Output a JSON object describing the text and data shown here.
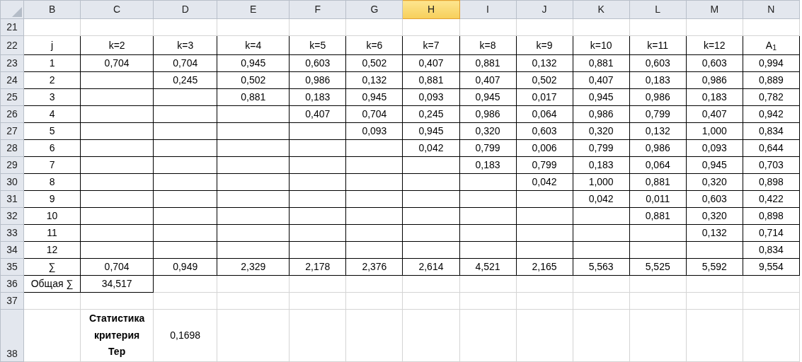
{
  "columns": [
    {
      "label": "B",
      "selected": false
    },
    {
      "label": "C",
      "selected": false
    },
    {
      "label": "D",
      "selected": false
    },
    {
      "label": "E",
      "selected": false
    },
    {
      "label": "F",
      "selected": false
    },
    {
      "label": "G",
      "selected": false
    },
    {
      "label": "H",
      "selected": true
    },
    {
      "label": "I",
      "selected": false
    },
    {
      "label": "J",
      "selected": false
    },
    {
      "label": "K",
      "selected": false
    },
    {
      "label": "L",
      "selected": false
    },
    {
      "label": "M",
      "selected": false
    },
    {
      "label": "N",
      "selected": false
    }
  ],
  "rows": [
    {
      "number": "21",
      "kind": "plain",
      "cells": {}
    },
    {
      "number": "22",
      "kind": "table",
      "cells": {
        "B": "j",
        "C": "k=2",
        "D": "k=3",
        "E": "k=4",
        "F": "k=5",
        "G": "k=6",
        "H": "k=7",
        "I": "k=8",
        "J": "k=9",
        "K": "k=10",
        "L": "k=11",
        "M": "k=12",
        "N": "A$_{1}$"
      }
    },
    {
      "number": "23",
      "kind": "table",
      "cells": {
        "B": "1",
        "C": "0,704",
        "D": "0,704",
        "E": "0,945",
        "F": "0,603",
        "G": "0,502",
        "H": "0,407",
        "I": "0,881",
        "J": "0,132",
        "K": "0,881",
        "L": "0,603",
        "M": "0,603",
        "N": "0,994"
      }
    },
    {
      "number": "24",
      "kind": "table",
      "cells": {
        "B": "2",
        "D": "0,245",
        "E": "0,502",
        "F": "0,986",
        "G": "0,132",
        "H": "0,881",
        "I": "0,407",
        "J": "0,502",
        "K": "0,407",
        "L": "0,183",
        "M": "0,986",
        "N": "0,889"
      }
    },
    {
      "number": "25",
      "kind": "table",
      "cells": {
        "B": "3",
        "E": "0,881",
        "F": "0,183",
        "G": "0,945",
        "H": "0,093",
        "I": "0,945",
        "J": "0,017",
        "K": "0,945",
        "L": "0,986",
        "M": "0,183",
        "N": "0,782"
      }
    },
    {
      "number": "26",
      "kind": "table",
      "cells": {
        "B": "4",
        "F": "0,407",
        "G": "0,704",
        "H": "0,245",
        "I": "0,986",
        "J": "0,064",
        "K": "0,986",
        "L": "0,799",
        "M": "0,407",
        "N": "0,942"
      }
    },
    {
      "number": "27",
      "kind": "table",
      "cells": {
        "B": "5",
        "G": "0,093",
        "H": "0,945",
        "I": "0,320",
        "J": "0,603",
        "K": "0,320",
        "L": "0,132",
        "M": "1,000",
        "N": "0,834"
      }
    },
    {
      "number": "28",
      "kind": "table",
      "cells": {
        "B": "6",
        "H": "0,042",
        "I": "0,799",
        "J": "0,006",
        "K": "0,799",
        "L": "0,986",
        "M": "0,093",
        "N": "0,644"
      }
    },
    {
      "number": "29",
      "kind": "table",
      "cells": {
        "B": "7",
        "I": "0,183",
        "J": "0,799",
        "K": "0,183",
        "L": "0,064",
        "M": "0,945",
        "N": "0,703"
      }
    },
    {
      "number": "30",
      "kind": "table",
      "cells": {
        "B": "8",
        "J": "0,042",
        "K": "1,000",
        "L": "0,881",
        "M": "0,320",
        "N": "0,898"
      }
    },
    {
      "number": "31",
      "kind": "table",
      "cells": {
        "B": "9",
        "K": "0,042",
        "L": "0,011",
        "M": "0,603",
        "N": "0,422"
      }
    },
    {
      "number": "32",
      "kind": "table",
      "cells": {
        "B": "10",
        "L": "0,881",
        "M": "0,320",
        "N": "0,898"
      }
    },
    {
      "number": "33",
      "kind": "table",
      "cells": {
        "B": "11",
        "M": "0,132",
        "N": "0,714"
      }
    },
    {
      "number": "34",
      "kind": "table",
      "cells": {
        "B": "12",
        "N": "0,834"
      }
    },
    {
      "number": "35",
      "kind": "table",
      "cells": {
        "B": "∑",
        "C": "0,704",
        "D": "0,949",
        "E": "2,329",
        "F": "2,178",
        "G": "2,376",
        "H": "2,614",
        "I": "4,521",
        "J": "2,165",
        "K": "5,563",
        "L": "5,525",
        "M": "5,592",
        "N": "9,554"
      }
    },
    {
      "number": "36",
      "kind": "total",
      "cells": {
        "B": "Общая ∑",
        "C": "34,517"
      }
    },
    {
      "number": "37",
      "kind": "plain",
      "cells": {}
    },
    {
      "number": "38",
      "kind": "result",
      "cells": {
        "C": "Статистика критерия Тер",
        "D": "0,1698"
      }
    }
  ]
}
